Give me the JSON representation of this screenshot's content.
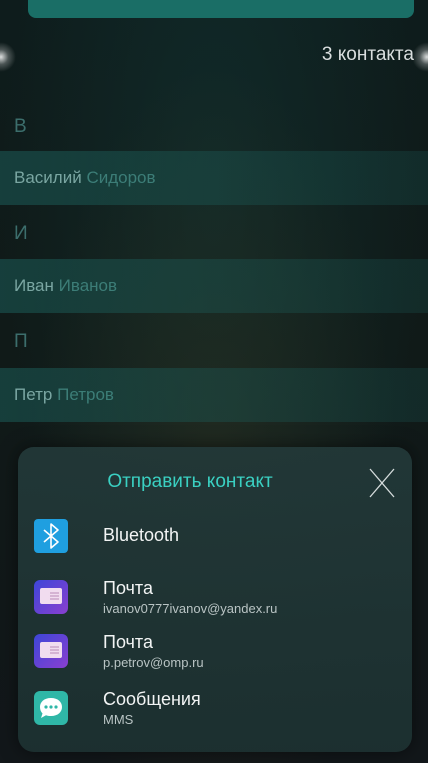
{
  "header": {
    "count_label": "3 контакта"
  },
  "contacts": [
    {
      "section": "В",
      "first": "Василий",
      "last": "Сидоров"
    },
    {
      "section": "И",
      "first": "Иван",
      "last": "Иванов"
    },
    {
      "section": "П",
      "first": "Петр",
      "last": "Петров"
    }
  ],
  "share_sheet": {
    "title": "Отправить контакт",
    "options": [
      {
        "icon": "bluetooth-icon",
        "label": "Bluetooth",
        "sublabel": ""
      },
      {
        "icon": "mail-icon",
        "label": "Почта",
        "sublabel": "ivanov0777ivanov@yandex.ru"
      },
      {
        "icon": "mail-icon",
        "label": "Почта",
        "sublabel": "p.petrov@omp.ru"
      },
      {
        "icon": "messages-icon",
        "label": "Сообщения",
        "sublabel": "MMS"
      }
    ]
  },
  "colors": {
    "accent": "#3ad0c2",
    "contact_first": "#7aa6a2",
    "contact_last": "#3c7d77",
    "section_header": "#3c6e6c"
  }
}
